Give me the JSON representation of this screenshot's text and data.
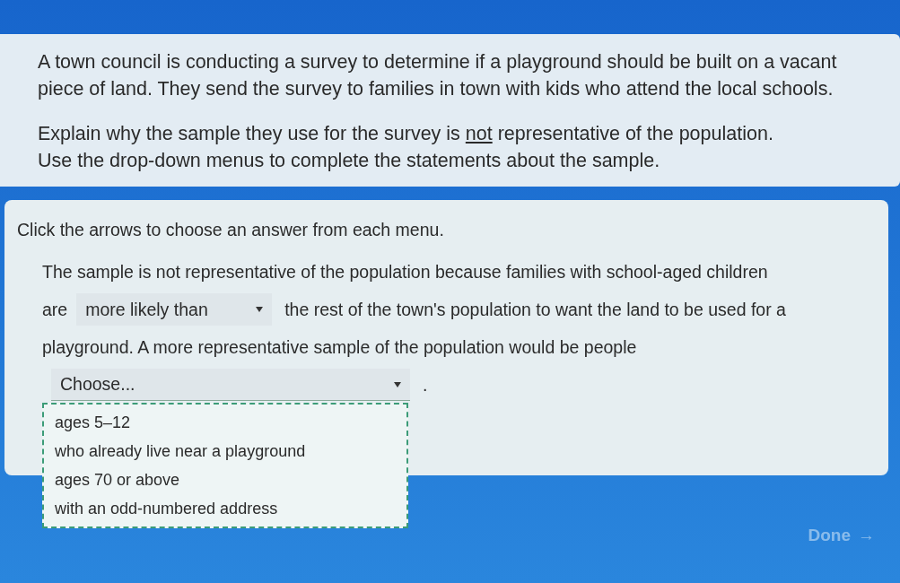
{
  "question": {
    "paragraphs": [
      "A town council is conducting a survey to determine if a playground should be built on a vacant piece of land. They send the survey to families in town with kids who attend the local schools."
    ],
    "instruction": {
      "before": "Explain why the sample they use for the survey is ",
      "underlined": "not",
      "after": " representative of the population."
    },
    "direction": "Use the drop-down menus to complete the statements about the sample."
  },
  "answer": {
    "hint": "Click the arrows to choose an answer from each menu.",
    "lines": [
      [
        {
          "kind": "text",
          "text": "The sample is not representative of the population because families with school-aged children"
        }
      ],
      [
        {
          "kind": "text",
          "text": "are"
        },
        {
          "kind": "select",
          "value": "more likely than",
          "expanded": false
        },
        {
          "kind": "text",
          "text": "the rest of the town's population to want the land to be used for a"
        }
      ],
      [
        {
          "kind": "text",
          "text": "playground. A more representative sample of the population would be people"
        }
      ],
      [
        {
          "kind": "select",
          "value": "Choose...",
          "expanded": true,
          "options": [
            {
              "label": "ages 5–12",
              "selected": false
            },
            {
              "label": "who already live near a playground",
              "selected": false
            },
            {
              "label": "ages 70 or above",
              "selected": false
            },
            {
              "label": "with an odd-numbered address",
              "selected": false
            }
          ]
        },
        {
          "kind": "text",
          "text": "."
        }
      ]
    ]
  },
  "done_button": {
    "label": "Done",
    "arrow": "→",
    "disabled": true
  }
}
